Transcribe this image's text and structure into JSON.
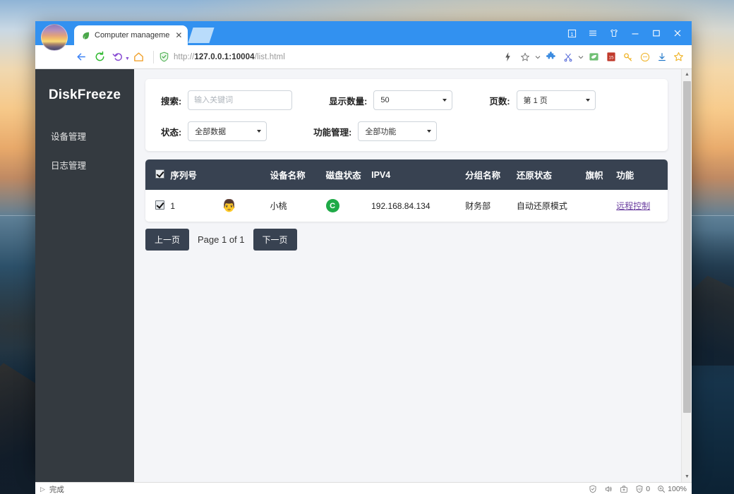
{
  "browser": {
    "tab": {
      "title": "Computer manageme",
      "favicon": "leaf-icon",
      "close": "✕"
    },
    "url": {
      "prefix": "http://",
      "host": "127.0.0.1:10004",
      "path": "/list.html",
      "shield": "security-shield-icon"
    },
    "nav": {
      "back": "back-arrow-icon",
      "reload": "reload-icon",
      "history": "history-back-icon",
      "home": "home-icon"
    },
    "toolbar_icons": [
      "flash-icon",
      "star-outline-icon",
      "caret-down-icon",
      "puzzle-extension-icon",
      "scissors-screenshot-icon",
      "caret-down-icon",
      "ebook-reader-icon",
      "notes-red-icon",
      "key-password-icon",
      "smiley-icon",
      "download-icon",
      "favorites-star-icon"
    ],
    "window_controls": {
      "tab_count": "1",
      "menu": "☰",
      "skin": "shirt-theme-icon",
      "minimize": "–",
      "maximize": "□",
      "close": "✕"
    },
    "statusbar": {
      "play": "▷",
      "text": "完成",
      "shield": "security-icon",
      "sound": "sound-icon",
      "kit": "toolkit-icon",
      "adblock_label": "0",
      "zoom_label": "100%"
    }
  },
  "sidebar": {
    "brand": "DiskFreeze",
    "items": [
      {
        "label": "设备管理"
      },
      {
        "label": "日志管理"
      }
    ]
  },
  "filters": {
    "search": {
      "label": "搜索:",
      "value": "",
      "placeholder": "输入关键词"
    },
    "count": {
      "label": "显示数量:",
      "value": "50"
    },
    "page": {
      "label": "页数:",
      "value": "第 1 页"
    },
    "state": {
      "label": "状态:",
      "value": "全部数据"
    },
    "func": {
      "label": "功能管理:",
      "value": "全部功能"
    }
  },
  "table": {
    "headers": {
      "check": "",
      "seq": "序列号",
      "avatar": "",
      "name": "设备名称",
      "disk": "磁盘状态",
      "ip": "IPV4",
      "group": "分组名称",
      "restore": "还原状态",
      "flag": "旗帜",
      "func": "功能"
    },
    "rows": [
      {
        "checked": true,
        "seq": "1",
        "avatar": "👨",
        "name": "小桃",
        "disk": "C",
        "disk_color": "#1faa47",
        "ip": "192.168.84.134",
        "group": "财务部",
        "restore": "自动还原模式",
        "flag": "",
        "func": "远程控制"
      }
    ]
  },
  "pagination": {
    "prev": "上一页",
    "info": "Page 1 of 1",
    "next": "下一页"
  },
  "colors": {
    "titlebar": "#3291f0",
    "sidebar": "#343a40",
    "table_header": "#384251",
    "link": "#6b3fa0",
    "disk_green": "#1faa47"
  }
}
